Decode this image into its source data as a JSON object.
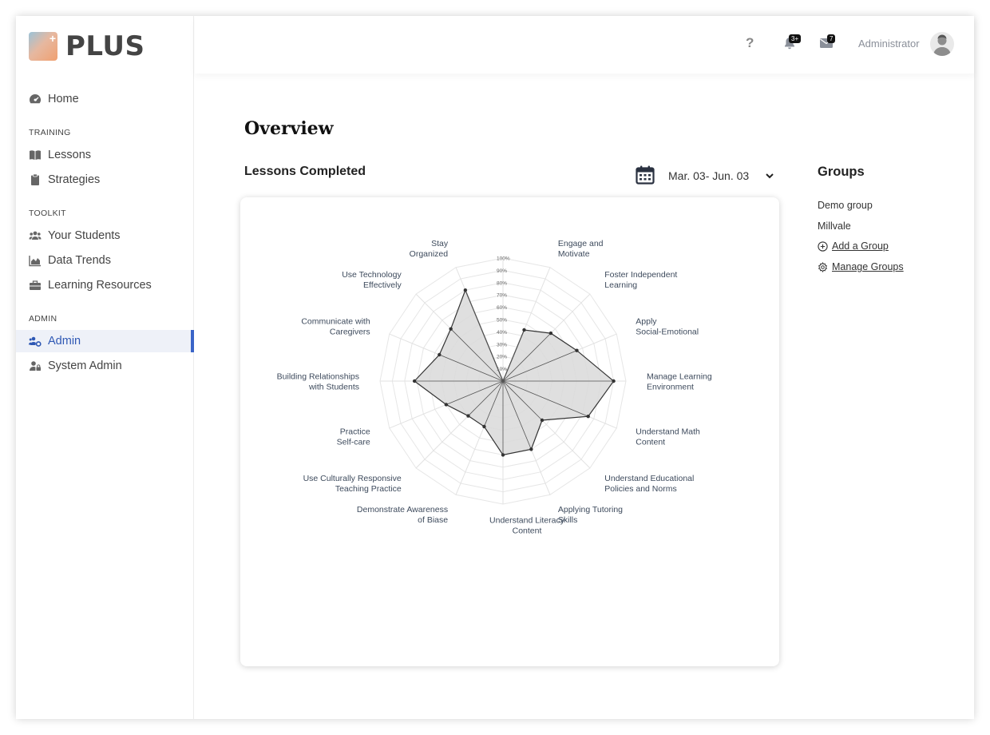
{
  "app": {
    "logo_text": "PLUS"
  },
  "sidebar": {
    "home": {
      "label": "Home",
      "icon": "dashboard-icon"
    },
    "sections": [
      {
        "label": "TRAINING",
        "items": [
          {
            "label": "Lessons",
            "icon": "book-icon"
          },
          {
            "label": "Strategies",
            "icon": "clipboard-icon"
          }
        ]
      },
      {
        "label": "TOOLKIT",
        "items": [
          {
            "label": "Your Students",
            "icon": "users-icon"
          },
          {
            "label": "Data Trends",
            "icon": "chart-area-icon"
          },
          {
            "label": "Learning Resources",
            "icon": "toolbox-icon"
          }
        ]
      },
      {
        "label": "ADMIN",
        "items": [
          {
            "label": "Admin",
            "icon": "users-gear-icon",
            "active": true
          },
          {
            "label": "System Admin",
            "icon": "user-lock-icon"
          }
        ]
      }
    ]
  },
  "header": {
    "help": "?",
    "notifications_badge": "3+",
    "messages_badge": "7",
    "user_name": "Administrator"
  },
  "main": {
    "title": "Overview",
    "card_title": "Lessons Completed",
    "date_range": "Mar. 03- Jun. 03"
  },
  "groups": {
    "title": "Groups",
    "items": [
      "Demo group",
      "Millvale"
    ],
    "add_label": "Add a Group",
    "manage_label": "Manage Groups"
  },
  "colors": {
    "accent": "#3a64c8",
    "radar_fill": "#d9d9d9",
    "radar_stroke": "#333333"
  },
  "chart_data": {
    "type": "radar",
    "axes": [
      [
        "Engage and",
        "Motivate"
      ],
      [
        "Foster Independent",
        "Learning"
      ],
      [
        "Apply",
        "Social-Emotional"
      ],
      [
        "Manage Learning",
        "Environment"
      ],
      [
        "Understand Math",
        "Content"
      ],
      [
        "Understand Educational",
        "Policies and Norms"
      ],
      [
        "Applying Tutoring",
        "Skills"
      ],
      [
        "Understand Literacy",
        "Content"
      ],
      [
        "Demonstrate Awareness",
        "of Biase"
      ],
      [
        "Use Culturally Responsive",
        "Teaching Practice"
      ],
      [
        "Practice",
        "Self-care"
      ],
      [
        "Building Relationships",
        "with Students"
      ],
      [
        "Communicate with",
        "Caregivers"
      ],
      [
        "Use Technology",
        "Effectively"
      ],
      [
        "Stay",
        "Organized"
      ]
    ],
    "values": [
      0,
      45,
      55,
      65,
      90,
      75,
      45,
      60,
      60,
      40,
      40,
      50,
      72,
      56,
      60,
      80
    ],
    "ticks": [
      "10%",
      "20%",
      "30%",
      "40%",
      "50%",
      "60%",
      "70%",
      "80%",
      "90%",
      "100%"
    ],
    "range": [
      0,
      100
    ]
  }
}
